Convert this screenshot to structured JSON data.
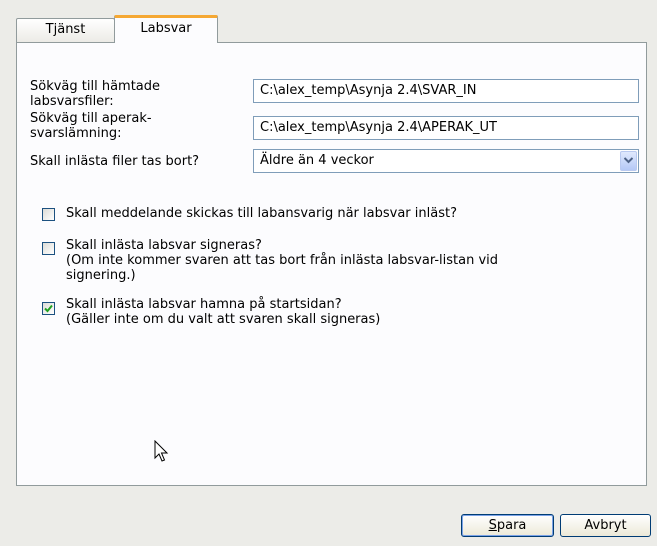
{
  "tabs": [
    {
      "label": "Tjänst",
      "active": false
    },
    {
      "label": "Labsvar",
      "active": true
    }
  ],
  "fields": {
    "download_path": {
      "label_line1": "Sökväg till hämtade",
      "label_line2": "labsvarsfiler:",
      "value": "C:\\alex_temp\\Asynja 2.4\\SVAR_IN"
    },
    "aperak_path": {
      "label_line1": "Sökväg till aperak-",
      "label_line2": "svarslämning:",
      "value": "C:\\alex_temp\\Asynja 2.4\\APERAK_UT"
    },
    "delete_files": {
      "label": "Skall inlästa filer tas bort?",
      "selected": "Äldre än 4 veckor"
    }
  },
  "checkboxes": [
    {
      "line1": "Skall meddelande skickas till labansvarig när labsvar inläst?",
      "checked": false
    },
    {
      "line1": "Skall inlästa labsvar signeras?",
      "line2": "(Om inte kommer svaren att tas bort från inlästa labsvar-listan vid",
      "line3": "signering.)",
      "checked": false
    },
    {
      "line1": "Skall inlästa labsvar hamna på startsidan?",
      "line2": "(Gäller inte om du valt att svaren skall signeras)",
      "checked": true
    }
  ],
  "buttons": {
    "save_mnemonic": "S",
    "save_rest": "para",
    "cancel": "Avbryt"
  },
  "colors": {
    "active_tab_accent": "#f5a833",
    "check_mark": "#21a121",
    "input_border": "#7f9db9"
  }
}
